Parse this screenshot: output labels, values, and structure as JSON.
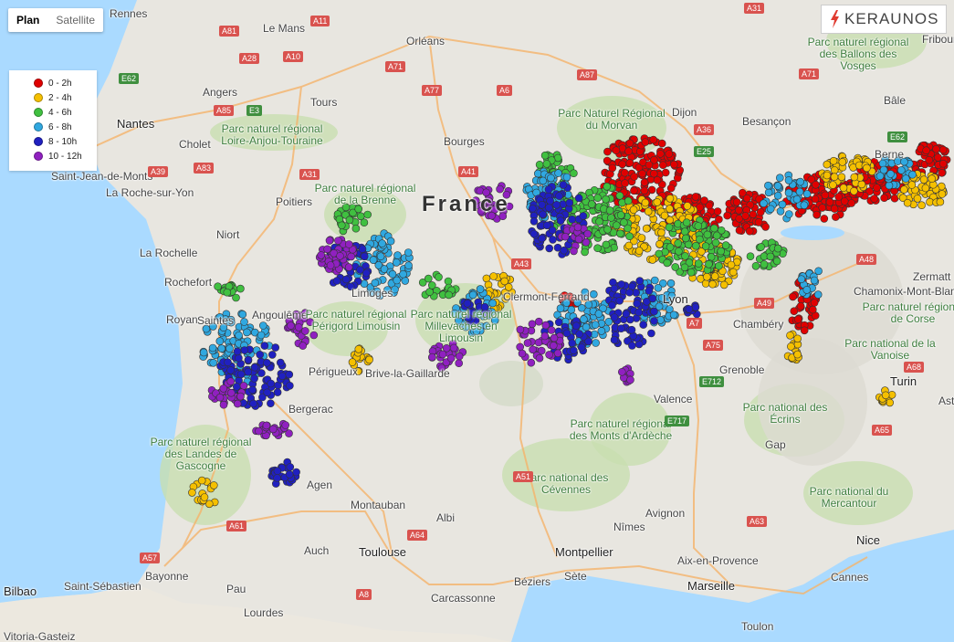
{
  "maptype": {
    "plan": "Plan",
    "satellite": "Satellite"
  },
  "brand": {
    "name": "KERAUNOS",
    "color": "#e03c31"
  },
  "legend": [
    {
      "label": "0 - 2h",
      "color": "#e00000"
    },
    {
      "label": "2 - 4h",
      "color": "#f5c000"
    },
    {
      "label": "4 - 6h",
      "color": "#40c040"
    },
    {
      "label": "6 - 8h",
      "color": "#30a8e0"
    },
    {
      "label": "8 - 10h",
      "color": "#2020c0"
    },
    {
      "label": "10 - 12h",
      "color": "#9020c0"
    }
  ],
  "country": "France",
  "cities": [
    "Rennes",
    "Le Mans",
    "Orléans",
    "Angers",
    "Tours",
    "Nantes",
    "Cholet",
    "Dijon",
    "Besançon",
    "Bourges",
    "Saint-Jean-de-Monts",
    "La Roche-sur-Yon",
    "Poitiers",
    "Niort",
    "La Rochelle",
    "Rochefort",
    "Royan",
    "Saintes",
    "Angoulême",
    "Limoges",
    "Périgueux",
    "Brive-la-Gaillarde",
    "Bergerac",
    "Agen",
    "Montauban",
    "Albi",
    "Toulouse",
    "Auch",
    "Bayonne",
    "Saint-Sébastien",
    "Bilbao",
    "Pau",
    "Lourdes",
    "Vitoria-Gasteiz",
    "Carcassonne",
    "Béziers",
    "Montpellier",
    "Sète",
    "Nîmes",
    "Avignon",
    "Aix-en-Provence",
    "Marseille",
    "Toulon",
    "Nice",
    "Cannes",
    "Valence",
    "Grenoble",
    "Chambéry",
    "Gap",
    "Turin",
    "Asti",
    "Zermatt",
    "Chamonix-Mont-Blanc",
    "Bâle",
    "Berne",
    "Fribourg",
    "Clermont-Ferrand",
    "Lyon"
  ],
  "parks": [
    "Parc naturel régional Loire-Anjou-Touraine",
    "Parc Naturel Régional du Morvan",
    "Parc naturel régional de la Brenne",
    "Parc naturel régional Périgord Limousin",
    "Parc naturel régional Millevaches en Limousin",
    "Parc naturel régional des Landes de Gascogne",
    "Parc national des Cévennes",
    "Parc naturel régional des Monts d'Ardèche",
    "Parc national des Écrins",
    "Parc national du Mercantour",
    "Parc naturel régional des Ballons des Vosges",
    "Parc naturel régional de Corse",
    "Parc national de la Vanoise"
  ],
  "roads": [
    "A31",
    "A81",
    "A11",
    "A28",
    "A10",
    "A71",
    "A77",
    "A6",
    "A87",
    "A85",
    "E3",
    "E62",
    "A83",
    "A39",
    "A31",
    "A36",
    "E25",
    "A71",
    "E62",
    "A41",
    "A43",
    "A48",
    "A49",
    "A7",
    "A75",
    "E712",
    "E717",
    "A51",
    "A68",
    "A65",
    "A63",
    "A64",
    "A61",
    "A57",
    "A8"
  ]
}
